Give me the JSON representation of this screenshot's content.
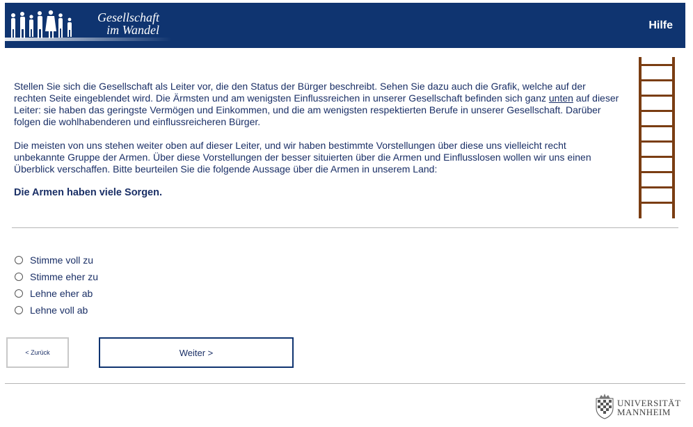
{
  "header": {
    "logo_line1": "Gesellschaft",
    "logo_line2": "im Wandel",
    "help_label": "Hilfe"
  },
  "intro": {
    "p1_a": "Stellen Sie sich die Gesellschaft als Leiter vor, die den Status der Bürger beschreibt. Sehen Sie dazu auch die Grafik, welche auf der rechten Seite eingeblendet wird. Die Ärmsten und am wenigsten Einflussreichen in unserer Gesellschaft befinden sich ganz ",
    "p1_u": "unten",
    "p1_b": " auf dieser Leiter: sie haben das geringste Vermögen und Einkommen, und die am wenigsten respektierten Berufe in unserer Gesellschaft. Darüber folgen die wohlhabenderen und einflussreicheren Bürger.",
    "p2": "Die meisten von uns stehen weiter oben auf dieser Leiter, und wir haben bestimmte Vorstellungen über diese uns vielleicht recht unbekannte Gruppe der Armen. Über diese Vorstellungen der besser situierten über die Armen und Einflusslosen wollen wir uns einen Überblick verschaffen. Bitte beurteilen Sie die folgende Aussage über die Armen in unserem Land:",
    "question": "Die Armen haben viele Sorgen."
  },
  "options": [
    {
      "label": "Stimme voll zu"
    },
    {
      "label": "Stimme eher zu"
    },
    {
      "label": "Lehne eher ab"
    },
    {
      "label": "Lehne voll ab"
    }
  ],
  "nav": {
    "back_label": "< Zurück",
    "next_label": "Weiter >"
  },
  "footer": {
    "uni_line1": "UNIVERSITÄT",
    "uni_line2": "MANNHEIM"
  },
  "colors": {
    "brand_blue": "#0f3470",
    "ladder_brown": "#7a3d12"
  }
}
